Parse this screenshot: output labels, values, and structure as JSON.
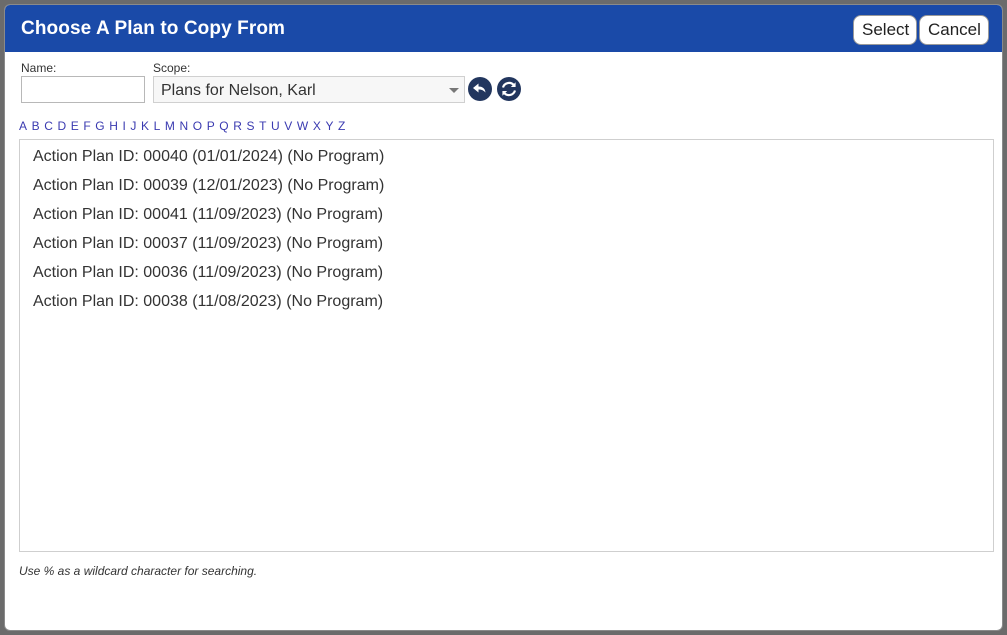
{
  "dialog": {
    "title": "Choose A Plan to Copy From",
    "select_label": "Select",
    "cancel_label": "Cancel"
  },
  "form": {
    "name_label": "Name:",
    "name_value": "",
    "scope_label": "Scope:",
    "scope_value": "Plans for Nelson, Karl"
  },
  "alphabet": [
    "A",
    "B",
    "C",
    "D",
    "E",
    "F",
    "G",
    "H",
    "I",
    "J",
    "K",
    "L",
    "M",
    "N",
    "O",
    "P",
    "Q",
    "R",
    "S",
    "T",
    "U",
    "V",
    "W",
    "X",
    "Y",
    "Z"
  ],
  "plans": [
    "Action Plan ID: 00040 (01/01/2024) (No Program)",
    "Action Plan ID: 00039 (12/01/2023) (No Program)",
    "Action Plan ID: 00041 (11/09/2023) (No Program)",
    "Action Plan ID: 00037 (11/09/2023) (No Program)",
    "Action Plan ID: 00036 (11/09/2023) (No Program)",
    "Action Plan ID: 00038 (11/08/2023) (No Program)"
  ],
  "hint": "Use % as a wildcard character for searching.",
  "colors": {
    "titlebar": "#1a4aa8",
    "icon_bg": "#22365e",
    "link": "#3a3ab0"
  }
}
